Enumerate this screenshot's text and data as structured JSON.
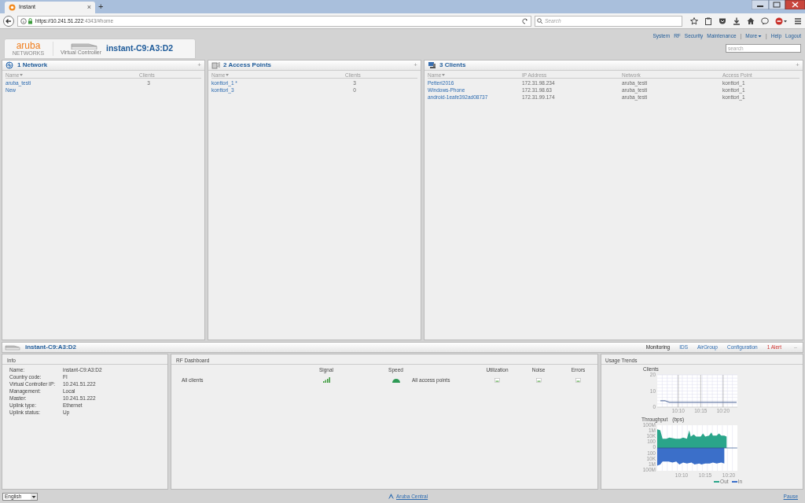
{
  "browser": {
    "tab_title": "Instant",
    "tab_close": "×",
    "new_tab": "+",
    "url_host": "https://10.241.51.222",
    "url_rest": ":4343/#home",
    "search_placeholder": "Search"
  },
  "header": {
    "logo": "aruba",
    "logo_sub": "NETWORKS",
    "device_label": "Virtual Controller",
    "title": "instant-C9:A3:D2",
    "search_placeholder": "search",
    "nav": [
      {
        "kind": "link",
        "label": "System"
      },
      {
        "kind": "link",
        "label": "RF"
      },
      {
        "kind": "link",
        "label": "Security"
      },
      {
        "kind": "link",
        "label": "Maintenance"
      },
      {
        "kind": "sep",
        "label": "|"
      },
      {
        "kind": "menu",
        "label": "More"
      },
      {
        "kind": "sep",
        "label": "|"
      },
      {
        "kind": "link",
        "label": "Help"
      },
      {
        "kind": "link",
        "label": "Logout"
      }
    ]
  },
  "panels": [
    {
      "kind": "network",
      "title": "1 Network",
      "add": "+",
      "columns": [
        {
          "label": "Name",
          "sorted": true
        },
        {
          "label": "Clients",
          "sorted": false
        }
      ],
      "rows": [
        [
          "aruba_testi",
          "3"
        ],
        [
          "New",
          ""
        ]
      ]
    },
    {
      "kind": "ap",
      "title": "2 Access Points",
      "add": "+",
      "columns": [
        {
          "label": "Name",
          "sorted": true
        },
        {
          "label": "Clients",
          "sorted": false
        }
      ],
      "rows": [
        [
          "konttori_1 *",
          "3"
        ],
        [
          "konttori_3",
          "0"
        ]
      ]
    },
    {
      "kind": "clients",
      "title": "3 Clients",
      "add": "+",
      "columns": [
        {
          "label": "Name",
          "sorted": true
        },
        {
          "label": "IP Address",
          "sorted": false
        },
        {
          "label": "Network",
          "sorted": false
        },
        {
          "label": "Access Point",
          "sorted": false
        }
      ],
      "rows": [
        [
          "Petteri2016",
          "172.31.98.234",
          "aruba_testi",
          "konttori_1"
        ],
        [
          "Windows-Phone",
          "172.31.98.63",
          "aruba_testi",
          "konttori_1"
        ],
        [
          "android-1eafe392ad08737",
          "172.31.99.174",
          "aruba_testi",
          "konttori_1"
        ]
      ]
    }
  ],
  "detail": {
    "title": "instant-C9:A3:D2",
    "collapse": "–",
    "tabs": [
      {
        "kind": "tab",
        "label": "Monitoring",
        "selected": true
      },
      {
        "kind": "tab",
        "label": "IDS",
        "selected": false
      },
      {
        "kind": "tab",
        "label": "AirGroup",
        "selected": false
      },
      {
        "kind": "tab",
        "label": "Configuration",
        "selected": false
      },
      {
        "kind": "alert",
        "label": "1 Alert",
        "selected": false
      }
    ],
    "info": {
      "title": "Info",
      "fields": [
        {
          "label": "Name:",
          "value": "instant-C9:A3:D2"
        },
        {
          "label": "Country code:",
          "value": "FI"
        },
        {
          "label": "Virtual Controller IP:",
          "value": "10.241.51.222"
        },
        {
          "label": "Management:",
          "value": "Local"
        },
        {
          "label": "Master:",
          "value": "10.241.51.222"
        },
        {
          "label": "Uplink type:",
          "value": "Ethernet"
        },
        {
          "label": "Uplink status:",
          "value": "Up"
        }
      ]
    },
    "rf": {
      "title": "RF Dashboard",
      "client_row": "All clients",
      "client_columns": [
        "Signal",
        "Speed"
      ],
      "ap_row": "All access points",
      "ap_columns": [
        "Utilization",
        "Noise",
        "Errors"
      ]
    },
    "usage": {
      "title": "Usage Trends",
      "clients_chart": {
        "chart_data": {
          "type": "line",
          "title": "Clients",
          "categories": [
            null,
            null,
            null,
            null,
            "10:10",
            null,
            null,
            null,
            null,
            "10:15",
            null,
            null,
            null,
            null,
            "10:20",
            null,
            null,
            null
          ],
          "series": [
            {
              "color": "#6b7fa8",
              "values": [
                4,
                4,
                3,
                3,
                3,
                3,
                3,
                3,
                3,
                3,
                3,
                3,
                3,
                3,
                3,
                3,
                3,
                3
              ]
            }
          ],
          "ylim": [
            0,
            20
          ],
          "yticks": [
            0,
            10,
            20
          ],
          "grid": true
        }
      },
      "throughput": {
        "title": "Throughput",
        "unit": "(bps)",
        "y_labels": [
          "100M",
          "1M",
          "10K",
          "100",
          "0",
          "100",
          "10K",
          "1M",
          "100M"
        ],
        "x_labels": [
          "10:10",
          "10:15",
          "10:20"
        ],
        "legend": [
          {
            "name": "Out",
            "color": "#2aa58a"
          },
          {
            "name": "In",
            "color": "#3b6fc9"
          }
        ]
      }
    }
  },
  "footer": {
    "language": "English",
    "center_link": "Aruba Central",
    "pause": "Pause"
  }
}
